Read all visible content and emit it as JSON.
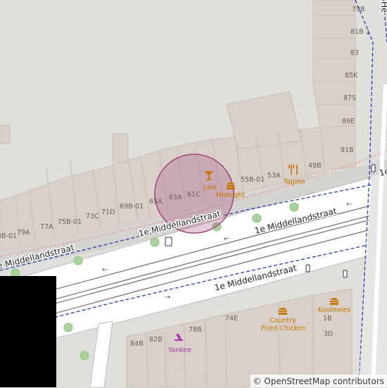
{
  "map": {
    "streets": [
      "1e Middellandstraat",
      "1e Middellandstraat",
      "1e Middellandstraat",
      "1e Middellandstraat",
      "He"
    ],
    "house_numbers_north": [
      "3B-01",
      "79A",
      "77A",
      "75B-01",
      "73C",
      "71D",
      "69B-01",
      "65A",
      "63A",
      "61C",
      "55B-01",
      "53A",
      "49B",
      "91B",
      "89E",
      "87S",
      "85K",
      "83",
      "81B",
      "79B"
    ],
    "house_numbers_south": [
      "84B",
      "82B",
      "78B",
      "74E",
      "1B",
      "3D"
    ],
    "pois": [
      {
        "name": "Lale",
        "icon": "cocktail-icon",
        "color": "#c77400"
      },
      {
        "name": "Midnight",
        "icon": "fast-food-icon",
        "color": "#c77400"
      },
      {
        "name": "Tagine",
        "icon": "restaurant-icon",
        "color": "#c77400"
      },
      {
        "name": "Country Fried Chicken",
        "line1": "Country",
        "line2": "Fried Chicken",
        "icon": "fast-food-icon",
        "color": "#c77400"
      },
      {
        "name": "Koolmees",
        "icon": "fast-food-icon",
        "color": "#c77400"
      },
      {
        "name": "Yankee",
        "icon": "shop-icon",
        "color": "#ac39ac"
      }
    ],
    "selection_circle_color": "#a0457a"
  },
  "attribution": {
    "symbol": "©",
    "text": "OpenStreetMap contributors"
  }
}
